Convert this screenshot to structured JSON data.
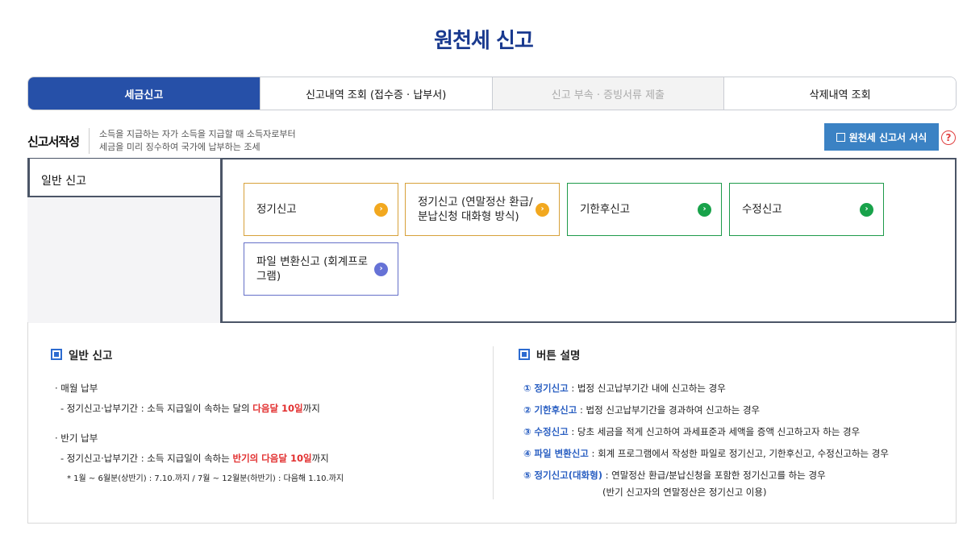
{
  "page": {
    "title": "원천세 신고"
  },
  "tabs": [
    {
      "label": "세금신고"
    },
    {
      "label": "신고내역 조회 (접수증 · 납부서)"
    },
    {
      "label": "신고 부속 · 증빙서류 제출"
    },
    {
      "label": "삭제내역 조회"
    }
  ],
  "section": {
    "title": "신고서작성",
    "desc1": "소득을 지급하는 자가 소득을 지급할 때 소득자로부터",
    "desc2": "세금을 미리 징수하여 국가에 납부하는 조세",
    "form_button": "원천세 신고서 서식",
    "help": "?"
  },
  "side_tab": {
    "label": "일반 신고"
  },
  "options": [
    {
      "label": "정기신고",
      "arrow": "›"
    },
    {
      "label": "정기신고 (연말정산 환급/분납신청 대화형 방식)",
      "arrow": "›"
    },
    {
      "label": "기한후신고",
      "arrow": "›"
    },
    {
      "label": "수정신고",
      "arrow": "›"
    },
    {
      "label": "파일 변환신고 (회계프로그램)",
      "arrow": "›"
    }
  ],
  "left_info": {
    "title": "일반 신고",
    "monthly_head": "· 매월 납부",
    "monthly_line_pre": "- 정기신고·납부기간 : 소득 지급일이 속하는 달의 ",
    "monthly_line_red": "다음달 10일",
    "monthly_line_post": "까지",
    "half_head": "· 반기 납부",
    "half_line_pre": "- 정기신고·납부기간 : 소득 지급일이 속하는 ",
    "half_line_red": "반기의 다음달 10일",
    "half_line_post": "까지",
    "half_note": "* 1월 ~ 6월분(상반기) : 7.10.까지 / 7월 ~ 12월분(하반기) : 다음해 1.10.까지"
  },
  "right_info": {
    "title": "버튼 설명",
    "items": [
      {
        "num": "①",
        "name": "정기신고",
        "desc": " : 법정 신고납부기간 내에 신고하는 경우"
      },
      {
        "num": "②",
        "name": "기한후신고",
        "desc": " : 법정 신고납부기간을 경과하여 신고하는 경우"
      },
      {
        "num": "③",
        "name": "수정신고",
        "desc": " : 당초 세금을 적게 신고하여 과세표준과 세액을 증액 신고하고자 하는 경우"
      },
      {
        "num": "④",
        "name": "파일 변환신고",
        "desc": " : 회계 프로그램에서 작성한 파일로 정기신고, 기한후신고, 수정신고하는 경우"
      },
      {
        "num": "⑤",
        "name": "정기신고(대화형)",
        "desc": " : 연말정산 환급/분납신청을 포함한 정기신고를 하는 경우"
      }
    ],
    "note": "(반기 신고자의 연말정산은 정기신고 이용)"
  }
}
